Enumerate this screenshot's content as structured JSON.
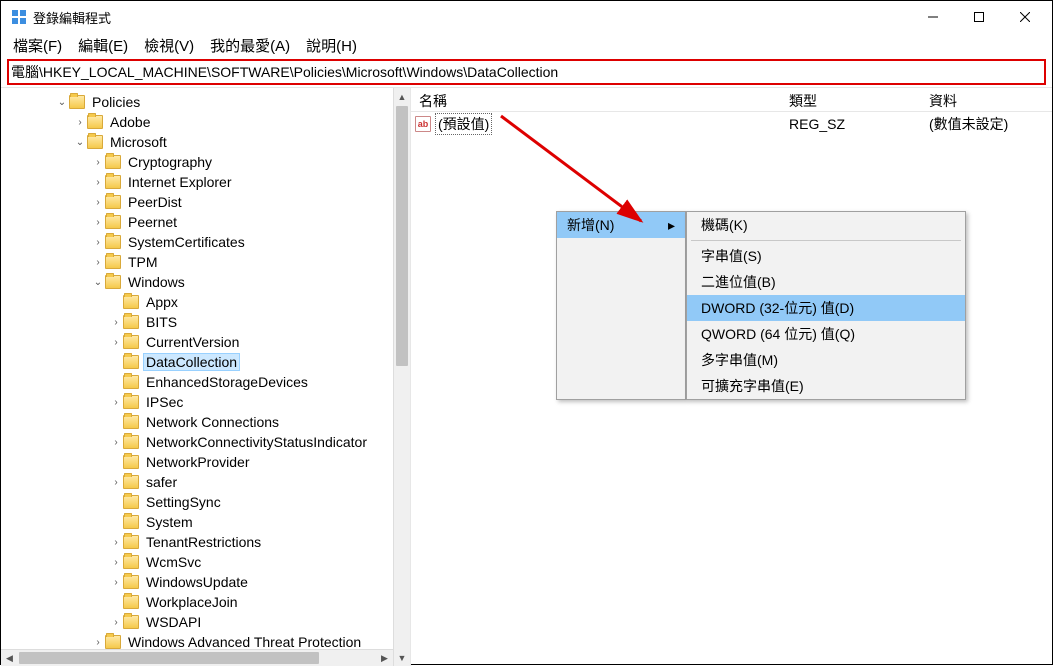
{
  "window": {
    "title": "登錄編輯程式"
  },
  "menus": [
    "檔案(F)",
    "編輯(E)",
    "檢視(V)",
    "我的最愛(A)",
    "說明(H)"
  ],
  "address": "電腦\\HKEY_LOCAL_MACHINE\\SOFTWARE\\Policies\\Microsoft\\Windows\\DataCollection",
  "tree": [
    {
      "label": "Policies",
      "indent": 3,
      "expand": "open"
    },
    {
      "label": "Adobe",
      "indent": 4,
      "expand": "closed"
    },
    {
      "label": "Microsoft",
      "indent": 4,
      "expand": "open"
    },
    {
      "label": "Cryptography",
      "indent": 5,
      "expand": "closed"
    },
    {
      "label": "Internet Explorer",
      "indent": 5,
      "expand": "closed"
    },
    {
      "label": "PeerDist",
      "indent": 5,
      "expand": "closed"
    },
    {
      "label": "Peernet",
      "indent": 5,
      "expand": "closed"
    },
    {
      "label": "SystemCertificates",
      "indent": 5,
      "expand": "closed"
    },
    {
      "label": "TPM",
      "indent": 5,
      "expand": "closed"
    },
    {
      "label": "Windows",
      "indent": 5,
      "expand": "open"
    },
    {
      "label": "Appx",
      "indent": 6,
      "expand": "none"
    },
    {
      "label": "BITS",
      "indent": 6,
      "expand": "closed"
    },
    {
      "label": "CurrentVersion",
      "indent": 6,
      "expand": "closed"
    },
    {
      "label": "DataCollection",
      "indent": 6,
      "expand": "none",
      "selected": true
    },
    {
      "label": "EnhancedStorageDevices",
      "indent": 6,
      "expand": "none"
    },
    {
      "label": "IPSec",
      "indent": 6,
      "expand": "closed"
    },
    {
      "label": "Network Connections",
      "indent": 6,
      "expand": "none"
    },
    {
      "label": "NetworkConnectivityStatusIndicator",
      "indent": 6,
      "expand": "closed"
    },
    {
      "label": "NetworkProvider",
      "indent": 6,
      "expand": "none"
    },
    {
      "label": "safer",
      "indent": 6,
      "expand": "closed"
    },
    {
      "label": "SettingSync",
      "indent": 6,
      "expand": "none"
    },
    {
      "label": "System",
      "indent": 6,
      "expand": "none"
    },
    {
      "label": "TenantRestrictions",
      "indent": 6,
      "expand": "closed"
    },
    {
      "label": "WcmSvc",
      "indent": 6,
      "expand": "closed"
    },
    {
      "label": "WindowsUpdate",
      "indent": 6,
      "expand": "closed"
    },
    {
      "label": "WorkplaceJoin",
      "indent": 6,
      "expand": "none"
    },
    {
      "label": "WSDAPI",
      "indent": 6,
      "expand": "closed"
    },
    {
      "label": "Windows Advanced Threat Protection",
      "indent": 5,
      "expand": "closed"
    }
  ],
  "list": {
    "headers": {
      "name": "名稱",
      "type": "類型",
      "data": "資料"
    },
    "rows": [
      {
        "name": "(預設值)",
        "type": "REG_SZ",
        "data": "(數值未設定)"
      }
    ]
  },
  "context": {
    "parent": {
      "label": "新增(N)"
    },
    "items": [
      {
        "label": "機碼(K)"
      },
      {
        "sep": true
      },
      {
        "label": "字串值(S)"
      },
      {
        "label": "二進位值(B)"
      },
      {
        "label": "DWORD (32-位元) 值(D)",
        "hl": true
      },
      {
        "label": "QWORD (64 位元) 值(Q)"
      },
      {
        "label": "多字串值(M)"
      },
      {
        "label": "可擴充字串值(E)"
      }
    ]
  }
}
